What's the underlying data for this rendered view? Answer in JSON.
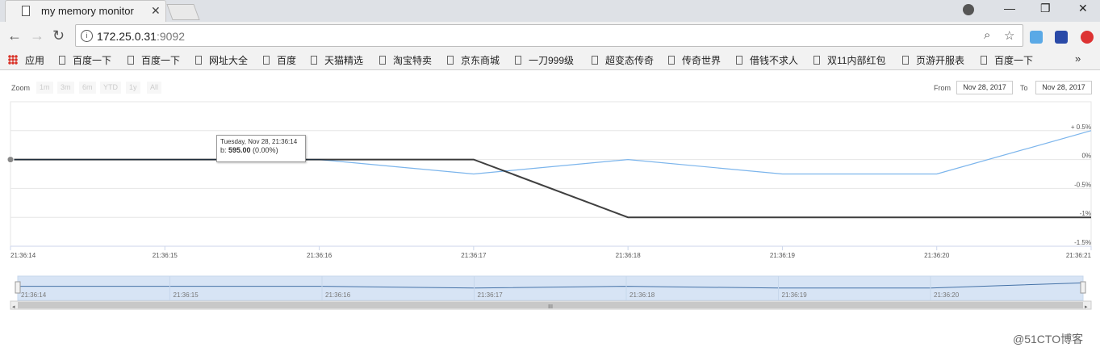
{
  "browser": {
    "tab_title": "my memory monitor",
    "url_host": "172.25.0.31",
    "url_port": ":9092"
  },
  "bookmarks": {
    "apps_label": "应用",
    "items": [
      "百度一下",
      "百度一下",
      "网址大全",
      "百度",
      "天猫精选",
      "淘宝特卖",
      "京东商城",
      "一刀999级",
      "超变态传奇",
      "传奇世界",
      "借钱不求人",
      "双11内部红包",
      "页游开服表",
      "百度一下"
    ]
  },
  "chart": {
    "zoom_label": "Zoom",
    "zoom_buttons": [
      "1m",
      "3m",
      "6m",
      "YTD",
      "1y",
      "All"
    ],
    "from_label": "From",
    "from_value": "Nov 28, 2017",
    "to_label": "To",
    "to_value": "Nov 28, 2017",
    "tooltip": {
      "date": "Tuesday, Nov 28, 21:36:14",
      "series_prefix": "b: ",
      "value": "595.00",
      "change": " (0.00%)"
    }
  },
  "chart_data": {
    "type": "line",
    "x": [
      "21:36:14",
      "21:36:15",
      "21:36:16",
      "21:36:17",
      "21:36:18",
      "21:36:19",
      "21:36:20",
      "21:36:21"
    ],
    "y_ticks": [
      "+ 0.5%",
      "0%",
      "-0.5%",
      "-1%",
      "-1.5%"
    ],
    "ylim": [
      -1.5,
      1.0
    ],
    "grid": true,
    "series": [
      {
        "name": "b",
        "color": "#000000",
        "values": [
          0,
          0,
          0,
          0,
          -1,
          -1,
          -1,
          -1
        ]
      },
      {
        "color": "#7cb5ec",
        "values": [
          0,
          0,
          0,
          -0.25,
          0,
          -0.25,
          -0.25,
          0.5
        ]
      }
    ],
    "navigator_labels": [
      "21:36:14",
      "21:36:15",
      "21:36:16",
      "21:36:17",
      "21:36:18",
      "21:36:19",
      "21:36:20"
    ]
  },
  "watermark": "@51CTO博客"
}
